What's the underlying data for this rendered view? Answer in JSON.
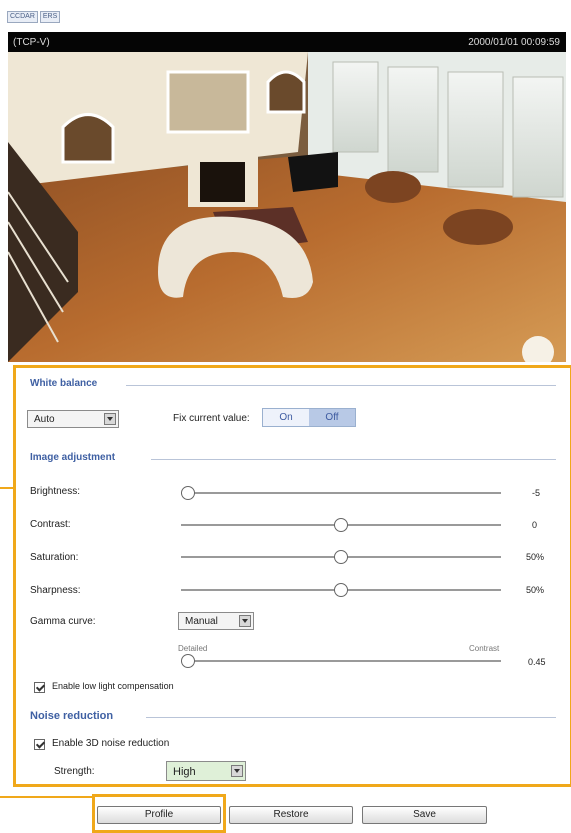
{
  "header": {
    "tabs": [
      "CCDAR",
      "ERS"
    ]
  },
  "video": {
    "protocol": "(TCP-V)",
    "timestamp": "2000/01/01 00:09:59"
  },
  "white_balance": {
    "title": "White balance",
    "mode_value": "Auto",
    "fix_label": "Fix current value:",
    "on_label": "On",
    "off_label": "Off"
  },
  "image_adjustment": {
    "title": "Image adjustment",
    "brightness": {
      "label": "Brightness:",
      "value": "-5",
      "level": 0.0
    },
    "contrast": {
      "label": "Contrast:",
      "value": "0",
      "level": 0.5
    },
    "saturation": {
      "label": "Saturation:",
      "value": "50%",
      "level": 0.5
    },
    "sharpness": {
      "label": "Sharpness:",
      "value": "50%",
      "level": 0.5
    },
    "gamma": {
      "label": "Gamma curve:",
      "mode_value": "Manual",
      "left_label": "Detailed",
      "right_label": "Contrast",
      "value": "0.45",
      "level": 0.0
    },
    "low_light_label": "Enable low light compensation"
  },
  "noise_reduction": {
    "title": "Noise reduction",
    "enable_label": "Enable 3D noise reduction",
    "strength_label": "Strength:",
    "strength_value": "High"
  },
  "buttons": {
    "profile": "Profile",
    "restore": "Restore",
    "save": "Save"
  },
  "colors": {
    "accent": "#f0a81a",
    "section_title": "#3f60a3"
  }
}
